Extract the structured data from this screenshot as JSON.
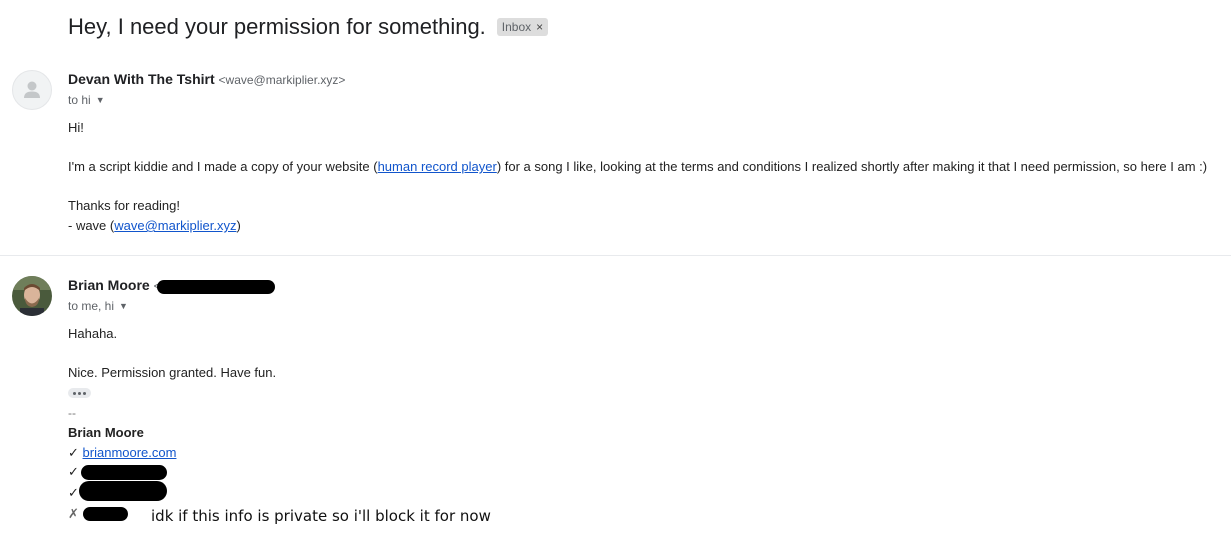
{
  "subject": "Hey, I need your permission for something.",
  "label": "Inbox",
  "label_close": "×",
  "messages": [
    {
      "sender_name": "Devan With The Tshirt",
      "sender_email": "<wave@markiplier.xyz>",
      "to": "to hi",
      "greeting": "Hi!",
      "body_pre": "I'm a script kiddie and I made a copy of your website (",
      "body_link": "human record player",
      "body_post": ") for a song I like, looking at the terms and conditions I realized shortly after making it that I need permission, so here I am :)",
      "thanks": "Thanks for reading!",
      "sign_pre": "- wave (",
      "sign_link": "wave@markiplier.xyz",
      "sign_post": ")"
    },
    {
      "sender_name": "Brian Moore",
      "sender_email_prefix": "<",
      "to": "to me, hi",
      "line1": "Hahaha.",
      "line2": "Nice. Permission granted. Have fun.",
      "sig_dash": "--",
      "sig_name": "Brian Moore",
      "check": "✓",
      "cross": "✗",
      "sig_link": "brianmoore.com",
      "annotation": "idk if this info is private so i'll block it for now"
    }
  ]
}
